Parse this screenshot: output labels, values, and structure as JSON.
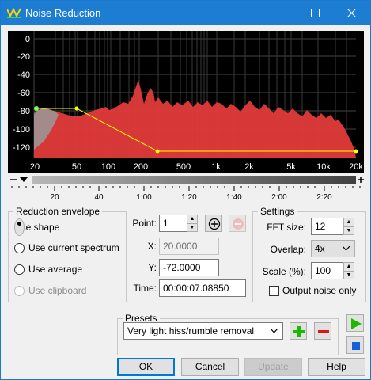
{
  "window": {
    "title": "Noise Reduction"
  },
  "spectrum": {
    "y_ticks": [
      "0",
      "-20",
      "-40",
      "-60",
      "-80",
      "-100",
      "-120"
    ],
    "x_ticks": [
      "20",
      "50",
      "100",
      "200",
      "500",
      "1k",
      "2k",
      "5k",
      "10k",
      "20k"
    ]
  },
  "timeline": {
    "ticks": [
      "20",
      "40",
      "1:00",
      "1:20",
      "1:40",
      "2:00",
      "2:20"
    ]
  },
  "reduction_envelope": {
    "legend": "Reduction envelope",
    "options": [
      {
        "label": "Use shape",
        "selected": true,
        "enabled": true
      },
      {
        "label": "Use current spectrum",
        "selected": false,
        "enabled": true
      },
      {
        "label": "Use average",
        "selected": false,
        "enabled": true
      },
      {
        "label": "Use clipboard",
        "selected": false,
        "enabled": false
      }
    ]
  },
  "point": {
    "point_label": "Point:",
    "point_value": "1",
    "x_label": "X:",
    "x_value": "20.0000",
    "y_label": "Y:",
    "y_value": "-72.0000",
    "time_label": "Time:",
    "time_value": "00:00:07.08850"
  },
  "settings": {
    "legend": "Settings",
    "fft_label": "FFT size:",
    "fft_value": "12",
    "overlap_label": "Overlap:",
    "overlap_value": "4x",
    "scale_label": "Scale (%):",
    "scale_value": "100",
    "output_noise_label": "Output noise only"
  },
  "presets": {
    "legend": "Presets",
    "selected": "Very light hiss/rumble removal"
  },
  "buttons": {
    "ok": "OK",
    "cancel": "Cancel",
    "update": "Update",
    "help": "Help"
  },
  "colors": {
    "accent": "#1c7dd2",
    "spectrum_fill": "#e23a3a",
    "curve": "#ffff00",
    "play": "#1fb800",
    "stop": "#1560d8"
  }
}
